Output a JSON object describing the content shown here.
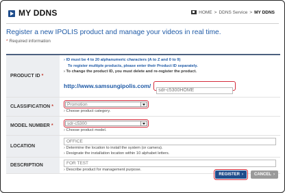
{
  "header": {
    "title": "MY DDNS",
    "breadcrumb": {
      "home": "HOME",
      "section": "DDNS Service",
      "current": "MY DDNS",
      "separator": ">"
    }
  },
  "intro": {
    "lead": "Register a new IPOLIS product and manage your videos in real time.",
    "required_note": "Required information",
    "required_mark": "*"
  },
  "form": {
    "product_id": {
      "label": "PRODUCT ID",
      "notes": [
        "ID must be 4 to 20 alphanumeric characters (A to Z and 0 to 9)",
        "To register multiple products, please enter their Product ID separately.",
        "To change the product ID, you must delete and re-register the product."
      ],
      "url_prefix": "http://www.samsungipolis.com/",
      "value": "sdr-c5300HOME"
    },
    "classification": {
      "label": "CLASSIFICATION",
      "selected": "Promotion",
      "hint": "Choose product category."
    },
    "model_number": {
      "label": "MODEL NUMBER",
      "selected": "sdr-c5300",
      "hint": "Choose product model."
    },
    "location": {
      "label": "LOCATION",
      "value": "OFFICE",
      "hints": [
        "Determine the location to install the system (or camera).",
        "Designate the installation location within 10 alphabet letters."
      ]
    },
    "description": {
      "label": "DESCRIPTION",
      "value": "FOR TEST",
      "hint": "Describe product for management purpose."
    }
  },
  "buttons": {
    "register": "REGISTER",
    "cancel": "CANCEL",
    "arrow": "›"
  },
  "colors": {
    "accent": "#1f4d8c",
    "link": "#1f5aa6",
    "highlight": "#d42a3a",
    "required": "#c0392b"
  }
}
